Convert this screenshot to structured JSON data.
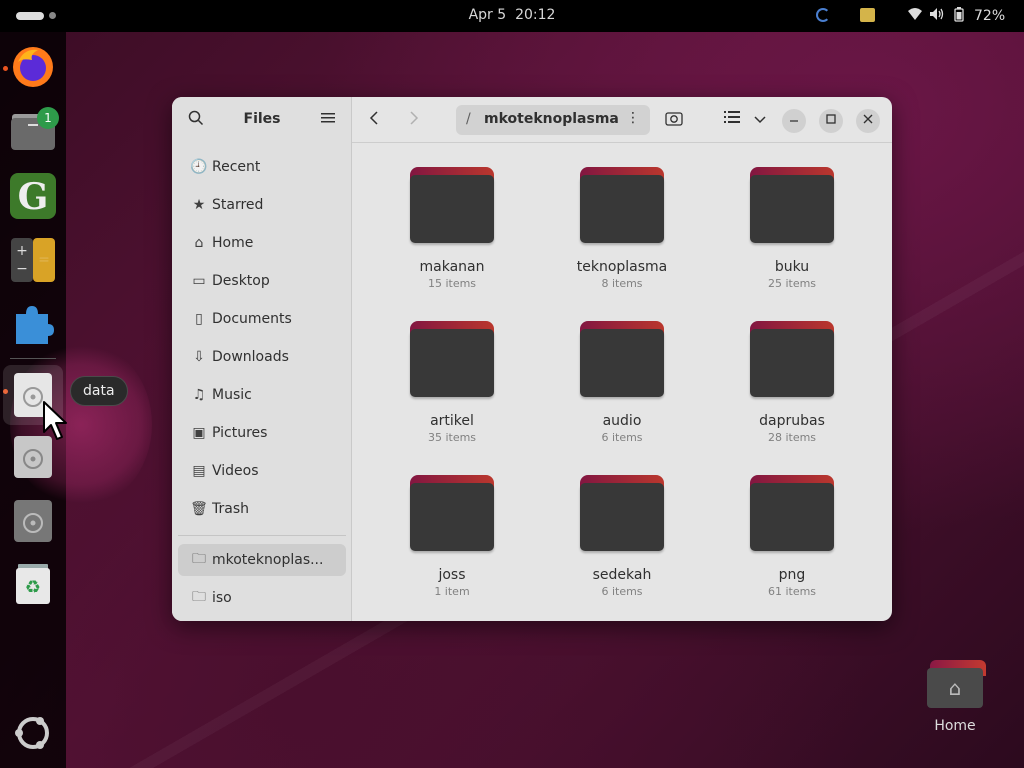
{
  "topbar": {
    "date": "Apr 5",
    "time": "20:12",
    "battery_percent": "72%",
    "icons": [
      "wifi-icon",
      "volume-icon",
      "battery-icon"
    ]
  },
  "dock": {
    "tooltip": "data",
    "files_badge": "1",
    "apps": [
      "firefox",
      "files",
      "gedit-g",
      "calculator",
      "extensions",
      "data-drive",
      "drive-2",
      "drive-3",
      "trash",
      "show-apps"
    ]
  },
  "window": {
    "sidebar": {
      "title": "Files",
      "items": [
        {
          "label": "Recent",
          "icon": "clock-icon"
        },
        {
          "label": "Starred",
          "icon": "star-icon"
        },
        {
          "label": "Home",
          "icon": "home-icon"
        },
        {
          "label": "Desktop",
          "icon": "desktop-icon"
        },
        {
          "label": "Documents",
          "icon": "document-icon"
        },
        {
          "label": "Downloads",
          "icon": "download-icon"
        },
        {
          "label": "Music",
          "icon": "music-icon"
        },
        {
          "label": "Pictures",
          "icon": "picture-icon"
        },
        {
          "label": "Videos",
          "icon": "video-icon"
        },
        {
          "label": "Trash",
          "icon": "trash-icon"
        }
      ],
      "bookmarks": [
        {
          "label": "mkoteknoplas...",
          "icon": "folder-icon"
        },
        {
          "label": "iso",
          "icon": "folder-icon"
        }
      ]
    },
    "path": {
      "slash": "/",
      "current": "mkoteknoplasma"
    },
    "folders": [
      {
        "name": "makanan",
        "count": "15 items"
      },
      {
        "name": "teknoplasma",
        "count": "8 items"
      },
      {
        "name": "buku",
        "count": "25 items"
      },
      {
        "name": "artikel",
        "count": "35 items"
      },
      {
        "name": "audio",
        "count": "6 items"
      },
      {
        "name": "daprubas",
        "count": "28 items"
      },
      {
        "name": "joss",
        "count": "1 item"
      },
      {
        "name": "sedekah",
        "count": "6 items"
      },
      {
        "name": "png",
        "count": "61 items"
      }
    ]
  },
  "desktop": {
    "home_label": "Home"
  },
  "colors": {
    "accent": "#e95420",
    "folder_tab": "#b52a3a",
    "folder_body": "#3c3c3c"
  }
}
